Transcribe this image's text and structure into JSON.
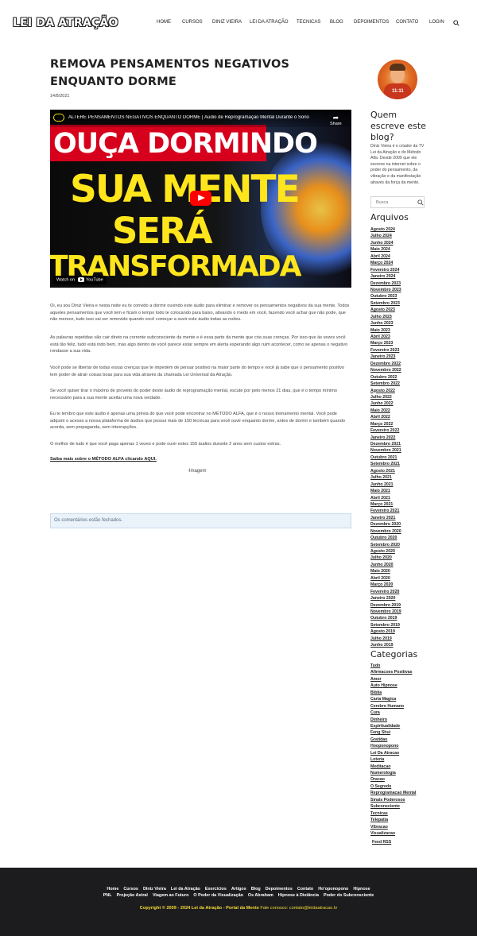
{
  "site": {
    "logo": "LEI DA ATRAÇÃO"
  },
  "nav": {
    "items": [
      "Home",
      "Cursos",
      "Diniz Vieira",
      "Lei da Atração",
      "Tecnicas",
      "Blog",
      "Depoimentos",
      "Contato",
      "Login"
    ],
    "search_icon": "search-icon"
  },
  "post": {
    "title": "Remova pensamentos negativos enquanto dorme",
    "date": "14/8/2021",
    "video": {
      "header_title": "ALTERE PENSAMENTOS NEGATIVOS ENQUANTO DORME | Áudio de Reprogramação Mental Durante o Sono",
      "share_label": "Share",
      "thumb_line1": "OUÇA DORMINDO",
      "thumb_line2": "SUA MENTE",
      "thumb_line3": "SERÁ",
      "thumb_line4": "TRANSFORMADA",
      "watch_on": "Watch on",
      "youtube_label": "YouTube"
    },
    "paragraphs": [
      "Oi, eu sou Diniz Vieira e nesta noite eu te convido a dormir ouvindo este áudio para eliminar e remover os pensamentos negativos da sua mente. Todos aqueles pensamentos que você tem e ficam o tempo todo te colocando para baixo, ativando o medo em você, fazendo você achar que não pode, que não merece, tudo isso vai ser removido quando você começar a ouvir este áudio todas as noites.",
      "As palavras repetidas vão cair direto na corrente subconsciente da mente e é essa parte da mente que cria suas crenças. Por isso que às vezes você está tão feliz, tudo está indo bem, mas algo dentro de você parece estar sempre em alerta esperando algo ruim acontecer, como se apenas o negativo rondasse a sua vida.",
      "Você pode se libertar de todas essas crenças que te impedem de pensar positivo na maior parte do tempo e você já sabe que o pensamento positivo tem poder de atrair coisas boas para sua vida através da chamada Lei Universal da Atração.",
      "Se você quiser tirar o máximo de proveito do poder deste áudio de reprogramação mental, escute por pelo menos 21 dias, que é o tempo mínimo necessário para a sua mente aceitar uma nova verdade.",
      "Eu te lembro que este áudio é apenas uma prévia do que você pode encontrar no MÉTODO ALFA, que é o nosso treinamento mental. Você pode adquirir o acesso a nossa plataforma de áudios que possui mais de 150 técnicas para você ouvir enquanto dorme, antes de dormir e também quando acorda, sem propaganda, sem interrupções.",
      "O melhor de tudo é que você paga apenas 1 vezes e pode ouvir estes 150 áudios durante 2 anos sem custos extras."
    ],
    "link_text": "Saiba mais sobre o MÉTODO ALFA clicando AQUI.",
    "image_alt": "Imagem",
    "comments_closed": "Os comentários estão fechados."
  },
  "sidebar": {
    "author_title": "Quem escreve este blog?",
    "avatar_text": "11:11",
    "bio": "Diniz Vieira é o criador da TV Lei da Atração e do Método Alfa. Desde 2009 que ele escreve na internet sobre o poder do pensamento, da vibração e da manifestação através da força da mente.",
    "search_placeholder": "Busca",
    "archives_title": "Arquivos",
    "archives": [
      "Agosto 2024",
      "Julho 2024",
      "Junho 2024",
      "Maio 2024",
      "Abril 2024",
      "Março 2024",
      "Fevereiro 2024",
      "Janeiro 2024",
      "Dezembro 2023",
      "Novembro 2023",
      "Outubro 2023",
      "Setembro 2023",
      "Agosto 2023",
      "Julho 2023",
      "Junho 2023",
      "Maio 2023",
      "Abril 2023",
      "Março 2023",
      "Fevereiro 2023",
      "Janeiro 2023",
      "Dezembro 2022",
      "Novembro 2022",
      "Outubro 2022",
      "Setembro 2022",
      "Agosto 2022",
      "Julho 2022",
      "Junho 2022",
      "Maio 2022",
      "Abril 2022",
      "Março 2022",
      "Fevereiro 2022",
      "Janeiro 2022",
      "Dezembro 2021",
      "Novembro 2021",
      "Outubro 2021",
      "Setembro 2021",
      "Agosto 2021",
      "Julho 2021",
      "Junho 2021",
      "Maio 2021",
      "Abril 2021",
      "Março 2021",
      "Fevereiro 2021",
      "Janeiro 2021",
      "Dezembro 2020",
      "Novembro 2020",
      "Outubro 2020",
      "Setembro 2020",
      "Agosto 2020",
      "Julho 2020",
      "Junho 2020",
      "Maio 2020",
      "Abril 2020",
      "Março 2020",
      "Fevereiro 2020",
      "Janeiro 2020",
      "Dezembro 2019",
      "Novembro 2019",
      "Outubro 2019",
      "Setembro 2019",
      "Agosto 2019",
      "Julho 2019",
      "Junho 2019"
    ],
    "categories_title": "Categorias",
    "categories": [
      "Tudo",
      "Afirmacoes Positivas",
      "Amor",
      "Auto Hipnose",
      "Biblia",
      "Carta Magica",
      "Cerebro Humano",
      "Cura",
      "Dinheiro",
      "Espiritualidade",
      "Feng Shui",
      "Gratidao",
      "Hooponopono",
      "Lei Da Atracao",
      "Loteria",
      "Meditacao",
      "Numerologia",
      "Oracao",
      "O Segredo",
      "Reprogramacao Mental",
      "Sinais Poderosos",
      "Subconsciente",
      "Tecnicas",
      "Telepatia",
      "Vibracao",
      "Visualizacao"
    ],
    "feed_rss": "Feed RSS"
  },
  "footer": {
    "row1": [
      "Home",
      "Cursos",
      "Diniz Vieira",
      "Lei da Atração",
      "Exercícios",
      "Artigos",
      "Blog",
      "Depoimentos",
      "Contato",
      "Ho'oponopono",
      "Hipnose"
    ],
    "row2": [
      "PNL",
      "Projeção Astral",
      "Viagem ao Futuro",
      "O Poder da Visualização",
      "Os Abraham",
      "Hipnose à Distância",
      "Poder do Subconsciente"
    ],
    "copyright": "Copyright © 2009 - 2024 Lei da Atração - Portal da Mente",
    "contact_label": "Fale conosco:",
    "contact_email": "contato@leidaatracao.tv"
  },
  "colors": {
    "accent_yellow": "#f5dc32",
    "footer_bg": "#1c1c1f",
    "comments_bg": "#eaf2fa",
    "youtube_red": "#ff0000"
  }
}
